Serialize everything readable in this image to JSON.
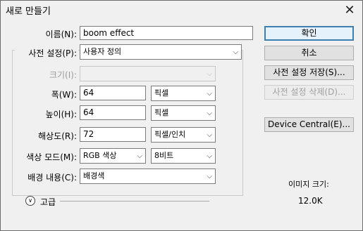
{
  "window": {
    "title": "새로 만들기",
    "close_glyph": "✕"
  },
  "form": {
    "name_label": "이름(N):",
    "name_value": "boom effect",
    "preset_label": "사전 설정(P):",
    "preset_value": "사용자 정의",
    "size_label": "크기(I):",
    "size_value": "",
    "width_label": "폭(W):",
    "width_value": "64",
    "width_unit": "픽셀",
    "height_label": "높이(H):",
    "height_value": "64",
    "height_unit": "픽셀",
    "resolution_label": "해상도(R):",
    "resolution_value": "72",
    "resolution_unit": "픽셀/인치",
    "color_mode_label": "색상 모드(M):",
    "color_mode_value": "RGB 색상",
    "bit_depth_value": "8비트",
    "background_label": "배경 내용(C):",
    "background_value": "배경색",
    "advanced_label": "고급"
  },
  "buttons": {
    "ok": "확인",
    "cancel": "취소",
    "save_preset": "사전 설정 저장(S)...",
    "delete_preset": "사전 설정 삭제(D)...",
    "device_central": "Device Central(E)..."
  },
  "info": {
    "image_size_label": "이미지 크기:",
    "image_size_value": "12.0K"
  },
  "icons": {
    "close": "close-icon",
    "dropdown": "chevron-down-icon",
    "advanced": "double-chevron-down-icon"
  },
  "colors": {
    "default_button_border": "#3c7fb1",
    "default_button_bg": "#e5f1fb",
    "disabled_text": "#9a9a9a"
  }
}
